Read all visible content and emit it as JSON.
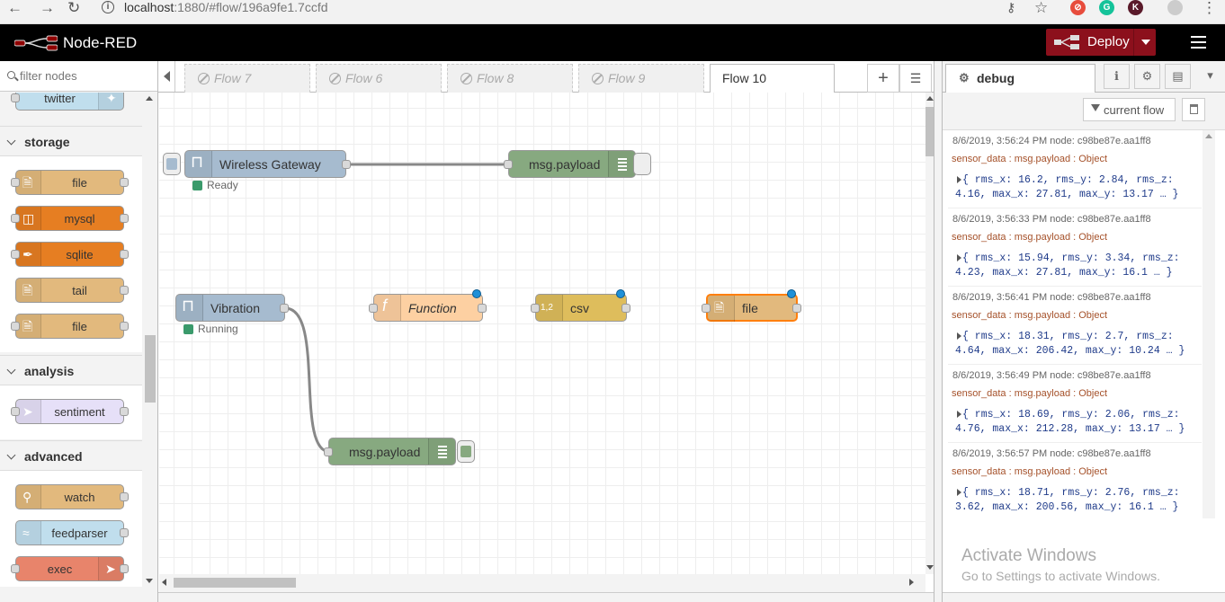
{
  "browser": {
    "url_host": "localhost",
    "url_rest": ":1880/#flow/196a9fe1.7ccfd",
    "extensions": [
      {
        "letter": "G",
        "color": "#15c39a"
      },
      {
        "letter": "K",
        "color": "#5a1a2a"
      }
    ]
  },
  "header": {
    "title": "Node-RED",
    "deploy_label": "Deploy"
  },
  "palette": {
    "filter_placeholder": "filter nodes",
    "top_node": "twitter",
    "categories": [
      {
        "name": "storage",
        "nodes": [
          "file",
          "mysql",
          "sqlite",
          "tail",
          "file"
        ]
      },
      {
        "name": "analysis",
        "nodes": [
          "sentiment"
        ]
      },
      {
        "name": "advanced",
        "nodes": [
          "watch",
          "feedparser",
          "exec"
        ]
      }
    ]
  },
  "tabs": [
    {
      "label": "Flow 7",
      "disabled": true
    },
    {
      "label": "Flow 6",
      "disabled": true
    },
    {
      "label": "Flow 8",
      "disabled": true
    },
    {
      "label": "Flow 9",
      "disabled": true
    },
    {
      "label": "Flow 10",
      "active": true
    }
  ],
  "workspace": {
    "nodes": {
      "wireless_gateway": {
        "label": "Wireless Gateway",
        "status": "Ready"
      },
      "debug1": {
        "label": "msg.payload"
      },
      "vibration": {
        "label": "Vibration",
        "status": "Running"
      },
      "function": {
        "label": "Function"
      },
      "csv": {
        "label": "csv"
      },
      "file": {
        "label": "file"
      },
      "debug2": {
        "label": "msg.payload"
      }
    },
    "csv_icon_text": "1,2"
  },
  "sidebar": {
    "tab_label": "debug",
    "filter_label": "current flow",
    "messages": [
      {
        "meta": "8/6/2019, 3:56:24 PM   node: c98be87e.aa1ff8",
        "topic": "sensor_data : msg.payload : Object",
        "line1": "{ rms_x: 16.2, rms_y: 2.84, rms_z:",
        "line2": "4.16, max_x: 27.81, max_y: 13.17 … }"
      },
      {
        "meta": "8/6/2019, 3:56:33 PM   node: c98be87e.aa1ff8",
        "topic": "sensor_data : msg.payload : Object",
        "line1": "{ rms_x: 15.94, rms_y: 3.34, rms_z:",
        "line2": "4.23, max_x: 27.81, max_y: 16.1 … }"
      },
      {
        "meta": "8/6/2019, 3:56:41 PM   node: c98be87e.aa1ff8",
        "topic": "sensor_data : msg.payload : Object",
        "line1": "{ rms_x: 18.31, rms_y: 2.7, rms_z:",
        "line2": "4.64, max_x: 206.42, max_y: 10.24 … }"
      },
      {
        "meta": "8/6/2019, 3:56:49 PM   node: c98be87e.aa1ff8",
        "topic": "sensor_data : msg.payload : Object",
        "line1": "{ rms_x: 18.69, rms_y: 2.06, rms_z:",
        "line2": "4.76, max_x: 212.28, max_y: 13.17 … }"
      },
      {
        "meta": "8/6/2019, 3:56:57 PM   node: c98be87e.aa1ff8",
        "topic": "sensor_data : msg.payload : Object",
        "line1": "{ rms_x: 18.71, rms_y: 2.76, rms_z:",
        "line2": "3.62, max_x: 200.56, max_y: 16.1 … }"
      }
    ]
  },
  "activate": {
    "title": "Activate Windows",
    "subtitle": "Go to Settings to activate Windows."
  },
  "colors": {
    "header_bg": "#000000",
    "deploy_bg": "#8c101c",
    "storage_node": "#e2b97d",
    "mysql_node": "#e67e22",
    "function_node": "#fdd0a2",
    "csv_node": "#debd5c",
    "debug_node": "#87a980",
    "input_node": "#a6bbcf",
    "analysis_node": "#e2d96e",
    "selected_border": "#ff7f0e"
  }
}
